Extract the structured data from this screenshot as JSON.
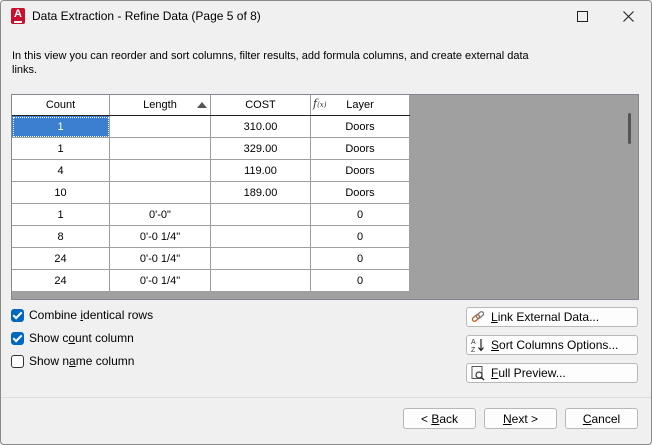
{
  "window": {
    "title": "Data Extraction - Refine Data (Page 5 of 8)",
    "app_icon_letter": "A",
    "maximize_icon": "maximize-icon",
    "close_icon": "close-icon"
  },
  "intro_text": "In this view you can reorder and sort columns, filter results, add formula columns, and create external data links.",
  "grid": {
    "columns": [
      "Count",
      "Length",
      "COST",
      "Layer"
    ],
    "sorted_column": "Length",
    "formula_column": "COST",
    "rows": [
      [
        "1",
        "",
        "310.00",
        "Doors"
      ],
      [
        "1",
        "",
        "329.00",
        "Doors"
      ],
      [
        "4",
        "",
        "119.00",
        "Doors"
      ],
      [
        "10",
        "",
        "189.00",
        "Doors"
      ],
      [
        "1",
        "0'-0\"",
        "",
        "0"
      ],
      [
        "8",
        "0'-0 1/4\"",
        "",
        "0"
      ],
      [
        "24",
        "0'-0 1/4\"",
        "",
        "0"
      ],
      [
        "24",
        "0'-0 1/4\"",
        "",
        "0"
      ]
    ]
  },
  "options": {
    "combine": {
      "pre": "Combine ",
      "u": "i",
      "post": "dentical rows",
      "checked": true
    },
    "count": {
      "pre": "Show c",
      "u": "o",
      "post": "unt column",
      "checked": true
    },
    "name": {
      "pre": "Show n",
      "u": "a",
      "post": "me column",
      "checked": false
    }
  },
  "side_buttons": {
    "link": {
      "u": "L",
      "rest": "ink External Data..."
    },
    "sort": {
      "u": "S",
      "rest": "ort Columns Options..."
    },
    "preview": {
      "u": "F",
      "rest": "ull Preview..."
    }
  },
  "nav": {
    "back": {
      "pre": "< ",
      "u": "B",
      "post": "ack"
    },
    "next": {
      "u": "N",
      "post": "ext >"
    },
    "cancel": {
      "u": "C",
      "post": "ancel"
    }
  },
  "colors": {
    "selection": "#3b7fd0",
    "checkbox_on": "#0067c0",
    "app_icon": "#c8102e"
  }
}
